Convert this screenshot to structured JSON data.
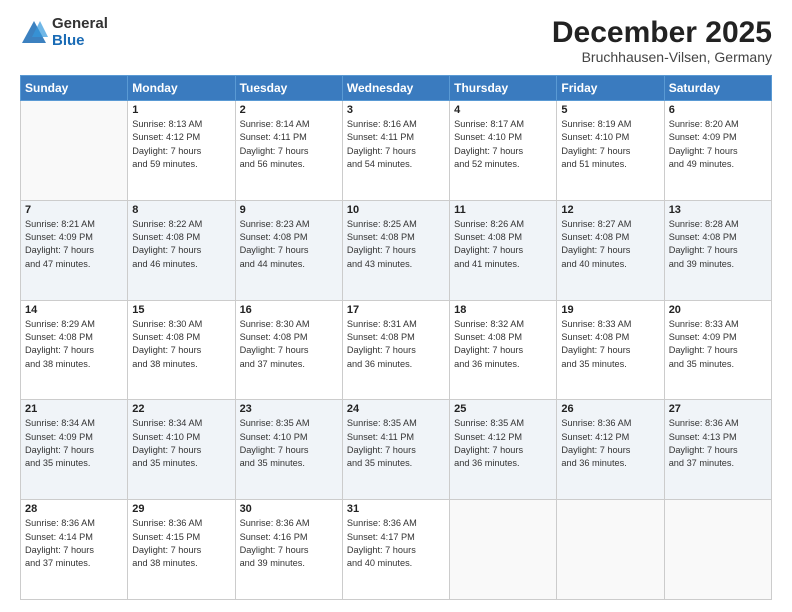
{
  "logo": {
    "general": "General",
    "blue": "Blue"
  },
  "header": {
    "month": "December 2025",
    "location": "Bruchhausen-Vilsen, Germany"
  },
  "weekdays": [
    "Sunday",
    "Monday",
    "Tuesday",
    "Wednesday",
    "Thursday",
    "Friday",
    "Saturday"
  ],
  "weeks": [
    [
      {
        "day": "",
        "info": ""
      },
      {
        "day": "1",
        "info": "Sunrise: 8:13 AM\nSunset: 4:12 PM\nDaylight: 7 hours\nand 59 minutes."
      },
      {
        "day": "2",
        "info": "Sunrise: 8:14 AM\nSunset: 4:11 PM\nDaylight: 7 hours\nand 56 minutes."
      },
      {
        "day": "3",
        "info": "Sunrise: 8:16 AM\nSunset: 4:11 PM\nDaylight: 7 hours\nand 54 minutes."
      },
      {
        "day": "4",
        "info": "Sunrise: 8:17 AM\nSunset: 4:10 PM\nDaylight: 7 hours\nand 52 minutes."
      },
      {
        "day": "5",
        "info": "Sunrise: 8:19 AM\nSunset: 4:10 PM\nDaylight: 7 hours\nand 51 minutes."
      },
      {
        "day": "6",
        "info": "Sunrise: 8:20 AM\nSunset: 4:09 PM\nDaylight: 7 hours\nand 49 minutes."
      }
    ],
    [
      {
        "day": "7",
        "info": "Sunrise: 8:21 AM\nSunset: 4:09 PM\nDaylight: 7 hours\nand 47 minutes."
      },
      {
        "day": "8",
        "info": "Sunrise: 8:22 AM\nSunset: 4:08 PM\nDaylight: 7 hours\nand 46 minutes."
      },
      {
        "day": "9",
        "info": "Sunrise: 8:23 AM\nSunset: 4:08 PM\nDaylight: 7 hours\nand 44 minutes."
      },
      {
        "day": "10",
        "info": "Sunrise: 8:25 AM\nSunset: 4:08 PM\nDaylight: 7 hours\nand 43 minutes."
      },
      {
        "day": "11",
        "info": "Sunrise: 8:26 AM\nSunset: 4:08 PM\nDaylight: 7 hours\nand 41 minutes."
      },
      {
        "day": "12",
        "info": "Sunrise: 8:27 AM\nSunset: 4:08 PM\nDaylight: 7 hours\nand 40 minutes."
      },
      {
        "day": "13",
        "info": "Sunrise: 8:28 AM\nSunset: 4:08 PM\nDaylight: 7 hours\nand 39 minutes."
      }
    ],
    [
      {
        "day": "14",
        "info": "Sunrise: 8:29 AM\nSunset: 4:08 PM\nDaylight: 7 hours\nand 38 minutes."
      },
      {
        "day": "15",
        "info": "Sunrise: 8:30 AM\nSunset: 4:08 PM\nDaylight: 7 hours\nand 38 minutes."
      },
      {
        "day": "16",
        "info": "Sunrise: 8:30 AM\nSunset: 4:08 PM\nDaylight: 7 hours\nand 37 minutes."
      },
      {
        "day": "17",
        "info": "Sunrise: 8:31 AM\nSunset: 4:08 PM\nDaylight: 7 hours\nand 36 minutes."
      },
      {
        "day": "18",
        "info": "Sunrise: 8:32 AM\nSunset: 4:08 PM\nDaylight: 7 hours\nand 36 minutes."
      },
      {
        "day": "19",
        "info": "Sunrise: 8:33 AM\nSunset: 4:08 PM\nDaylight: 7 hours\nand 35 minutes."
      },
      {
        "day": "20",
        "info": "Sunrise: 8:33 AM\nSunset: 4:09 PM\nDaylight: 7 hours\nand 35 minutes."
      }
    ],
    [
      {
        "day": "21",
        "info": "Sunrise: 8:34 AM\nSunset: 4:09 PM\nDaylight: 7 hours\nand 35 minutes."
      },
      {
        "day": "22",
        "info": "Sunrise: 8:34 AM\nSunset: 4:10 PM\nDaylight: 7 hours\nand 35 minutes."
      },
      {
        "day": "23",
        "info": "Sunrise: 8:35 AM\nSunset: 4:10 PM\nDaylight: 7 hours\nand 35 minutes."
      },
      {
        "day": "24",
        "info": "Sunrise: 8:35 AM\nSunset: 4:11 PM\nDaylight: 7 hours\nand 35 minutes."
      },
      {
        "day": "25",
        "info": "Sunrise: 8:35 AM\nSunset: 4:12 PM\nDaylight: 7 hours\nand 36 minutes."
      },
      {
        "day": "26",
        "info": "Sunrise: 8:36 AM\nSunset: 4:12 PM\nDaylight: 7 hours\nand 36 minutes."
      },
      {
        "day": "27",
        "info": "Sunrise: 8:36 AM\nSunset: 4:13 PM\nDaylight: 7 hours\nand 37 minutes."
      }
    ],
    [
      {
        "day": "28",
        "info": "Sunrise: 8:36 AM\nSunset: 4:14 PM\nDaylight: 7 hours\nand 37 minutes."
      },
      {
        "day": "29",
        "info": "Sunrise: 8:36 AM\nSunset: 4:15 PM\nDaylight: 7 hours\nand 38 minutes."
      },
      {
        "day": "30",
        "info": "Sunrise: 8:36 AM\nSunset: 4:16 PM\nDaylight: 7 hours\nand 39 minutes."
      },
      {
        "day": "31",
        "info": "Sunrise: 8:36 AM\nSunset: 4:17 PM\nDaylight: 7 hours\nand 40 minutes."
      },
      {
        "day": "",
        "info": ""
      },
      {
        "day": "",
        "info": ""
      },
      {
        "day": "",
        "info": ""
      }
    ]
  ]
}
